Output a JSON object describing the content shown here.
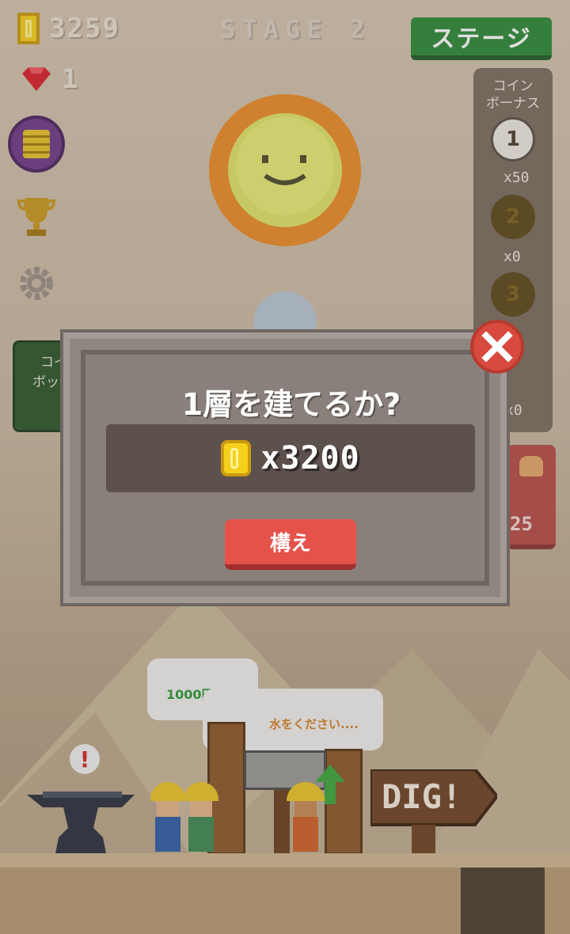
{
  "hud": {
    "coins": "3259",
    "stage": "STAGE 2",
    "stage_button": "ステージ",
    "gems": "1"
  },
  "coin_bonus": {
    "title_line1": "コイン",
    "title_line2": "ボーナス",
    "slots": [
      {
        "label": "1",
        "reward": "x50"
      },
      {
        "label": "2",
        "reward": "x0"
      },
      {
        "label": "3",
        "reward": ""
      },
      {
        "label": "",
        "reward": "x0"
      }
    ]
  },
  "left_panel": {
    "line1": "コイ",
    "line2": "ボッ"
  },
  "red_panel": {
    "value": "25"
  },
  "speech": {
    "bubble1": "1000円です",
    "bubble2": "水をください...."
  },
  "sign": {
    "text": "DIG!"
  },
  "dialog": {
    "title": "1層を建てるか?",
    "cost": "x3200",
    "build_button": "構え"
  },
  "colors": {
    "stage_button": "#2e8a3b",
    "build_button": "#e5524a",
    "close_button": "#d74a3d",
    "coin": "#f4d01c"
  }
}
